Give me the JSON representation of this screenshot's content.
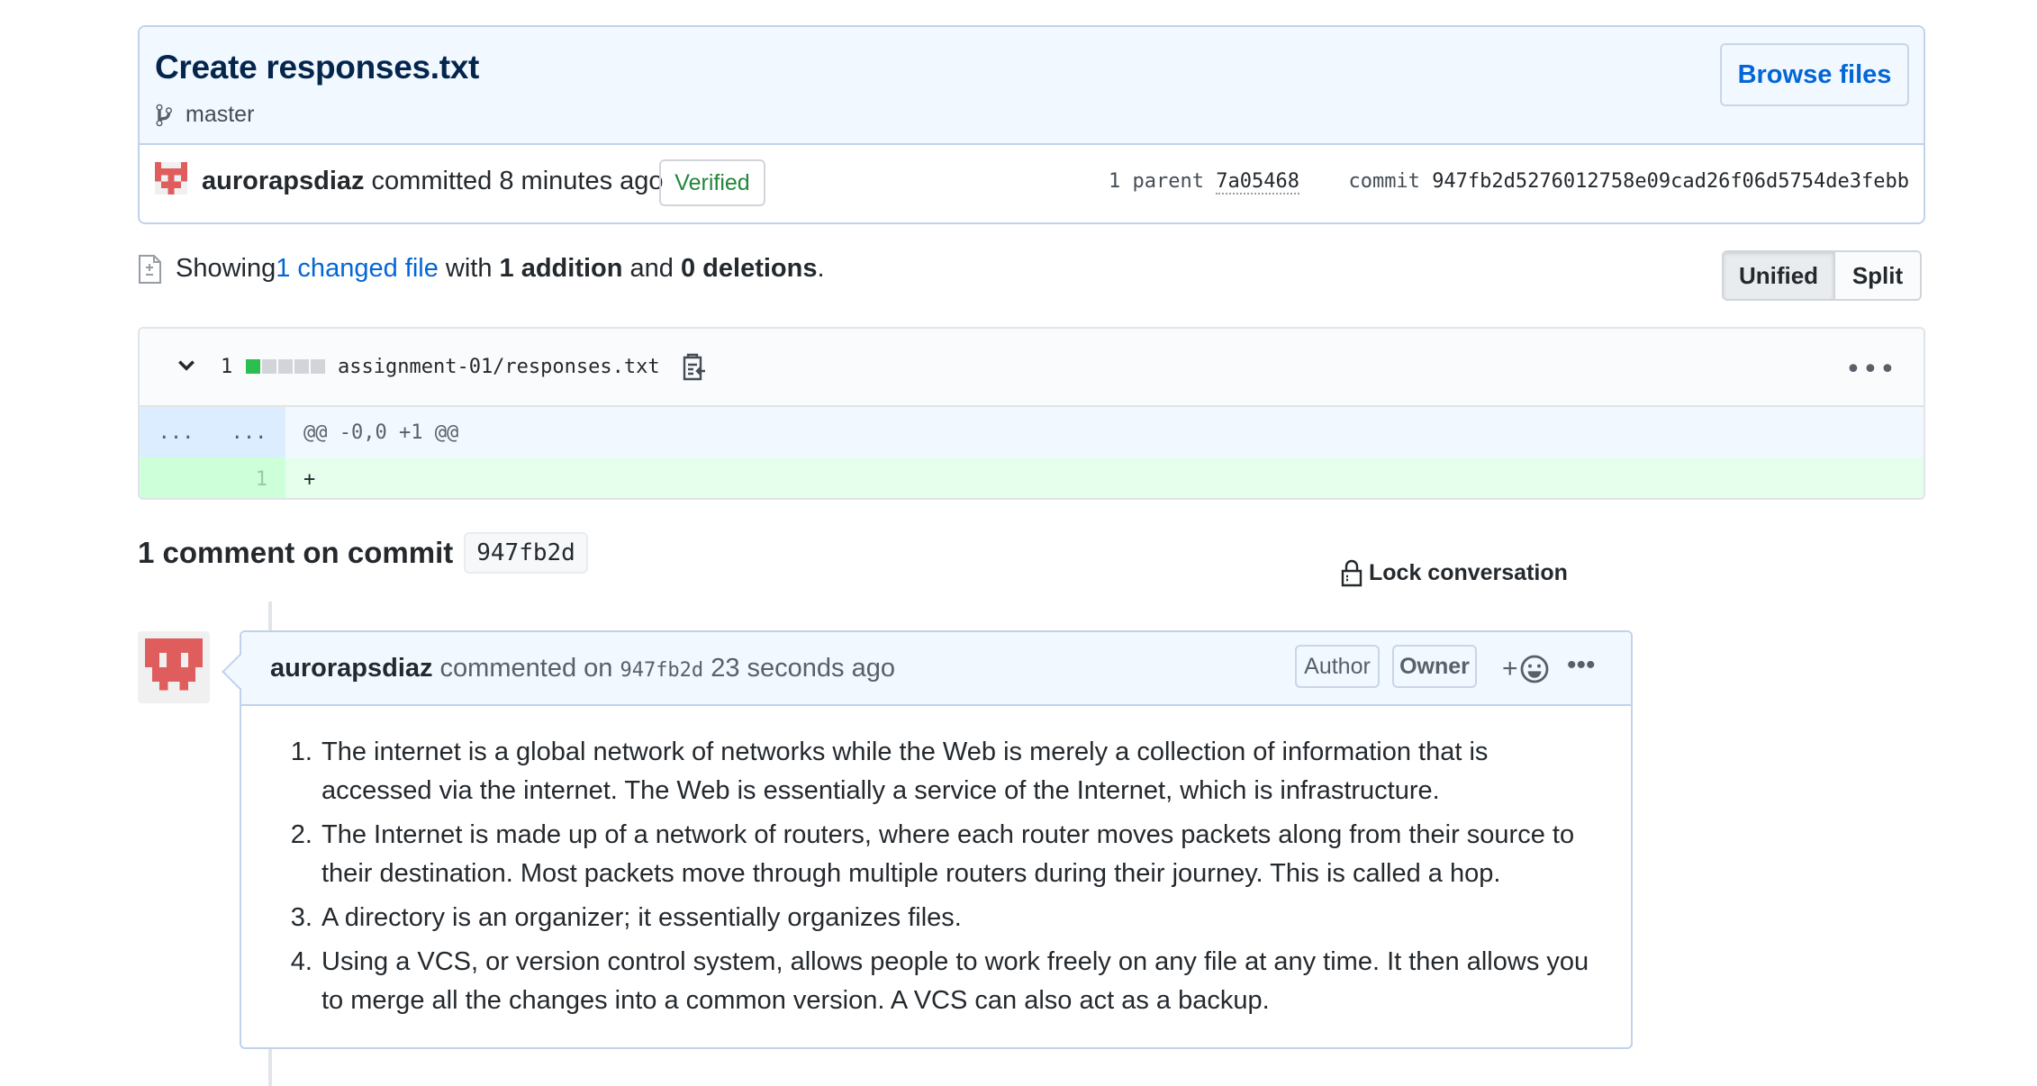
{
  "commit": {
    "title": "Create responses.txt",
    "branch": "master",
    "browse_label": "Browse files",
    "author": "aurorapsdiaz",
    "action_text": " committed 8 minutes ago",
    "verified_label": "Verified",
    "parent_label": "1 parent",
    "parent_sha": "7a05468",
    "commit_label": "commit",
    "commit_sha": "947fb2d5276012758e09cad26f06d5754de3febb"
  },
  "toc": {
    "showing": "Showing ",
    "changed_link": "1 changed file",
    "with": " with ",
    "additions": "1 addition",
    "and": " and ",
    "deletions": "0 deletions",
    "period": "."
  },
  "view_toggle": {
    "unified": "Unified",
    "split": "Split",
    "selected": "Unified"
  },
  "diff": {
    "count": "1",
    "stat_additions": 1,
    "stat_blocks": 5,
    "path": "assignment-01/responses.txt",
    "hunk_left": "...",
    "hunk_right": "...",
    "hunk_header": "@@ -0,0 +1 @@",
    "lines": [
      {
        "num": "1",
        "text": "+"
      }
    ]
  },
  "comments_section": {
    "heading": "1 comment on commit",
    "sha": "947fb2d",
    "lock_label": "Lock conversation"
  },
  "comment": {
    "author": "aurorapsdiaz",
    "commented_on": " commented on ",
    "sha": "947fb2d",
    "time": " 23 seconds ago",
    "author_badge": "Author",
    "owner_badge": "Owner",
    "react_plus": "+",
    "items": [
      "The internet is a global network of networks while the Web is merely a collection of information that is accessed via the internet. The Web is essentially a service of the Internet, which is infrastructure.",
      "The Internet is made up of a network of routers, where each router moves packets along from their source to their destination. Most packets move through multiple routers during their journey. This is called a hop.",
      "A directory is an organizer; it essentially organizes files.",
      "Using a VCS, or version control system, allows people to work freely on any file at any time. It then allows you to merge all the changes into a common version. A VCS can also act as a backup."
    ]
  },
  "colors": {
    "link": "#0366d6",
    "verified": "#22863a",
    "header_bg": "#f1f8ff",
    "add_bg": "#e6ffed",
    "avatar": "#e05d5d"
  }
}
